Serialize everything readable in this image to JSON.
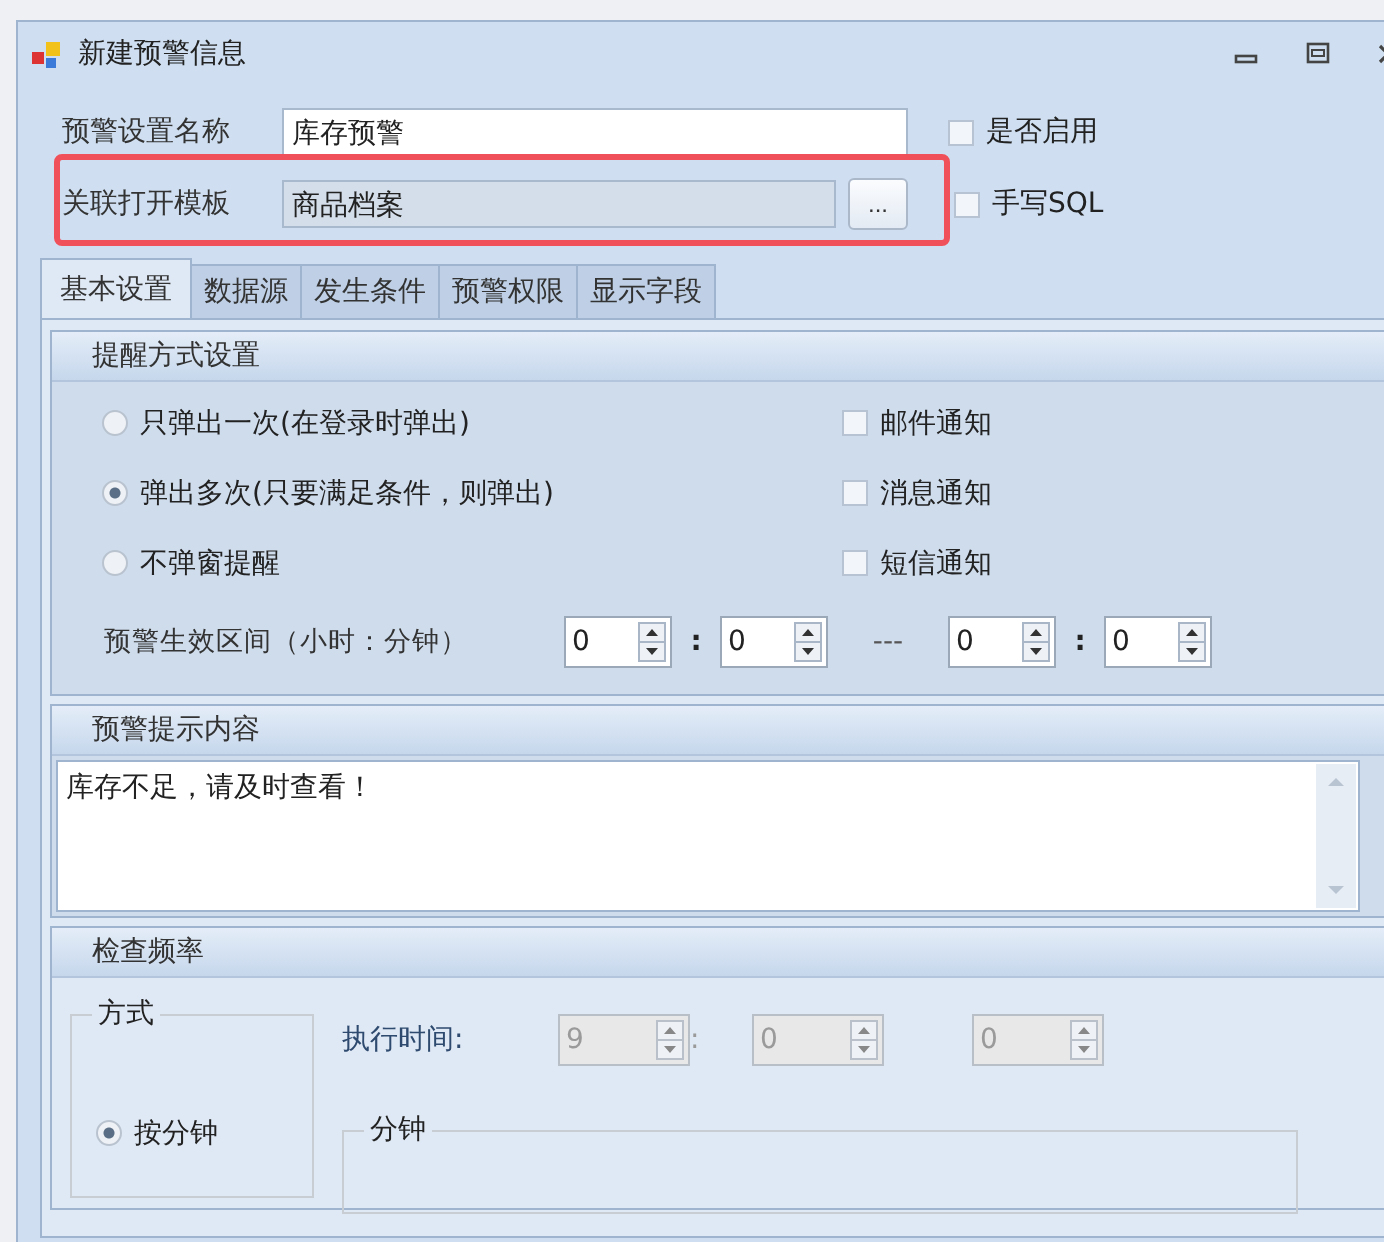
{
  "window": {
    "title": "新建预警信息"
  },
  "form": {
    "name_field": {
      "label": "预警设置名称",
      "value": "库存预警"
    },
    "enabled_checkbox": {
      "label": "是否启用",
      "checked": false
    },
    "template_field": {
      "label": "关联打开模板",
      "value": "商品档案",
      "disabled": true
    },
    "browse_button": {
      "label": "..."
    },
    "sql_checkbox": {
      "label": "手写SQL",
      "checked": false
    }
  },
  "tabs": [
    {
      "label": "基本设置",
      "selected": true
    },
    {
      "label": "数据源",
      "selected": false
    },
    {
      "label": "发生条件",
      "selected": false
    },
    {
      "label": "预警权限",
      "selected": false
    },
    {
      "label": "显示字段",
      "selected": false
    }
  ],
  "reminder_group": {
    "title": "提醒方式设置",
    "options": [
      {
        "label": "只弹出一次(在登录时弹出)",
        "selected": false
      },
      {
        "label": "弹出多次(只要满足条件，则弹出)",
        "selected": true
      },
      {
        "label": "不弹窗提醒",
        "selected": false
      }
    ],
    "notifications": [
      {
        "label": "邮件通知",
        "checked": false
      },
      {
        "label": "消息通知",
        "checked": false
      },
      {
        "label": "短信通知",
        "checked": false
      }
    ],
    "effective_range": {
      "label": "预警生效区间（小时：分钟）",
      "items": [
        {
          "kind": "spin",
          "value": "0",
          "disabled": false
        },
        {
          "kind": "sep",
          "text": ":"
        },
        {
          "kind": "spin",
          "value": "0",
          "disabled": false
        },
        {
          "kind": "sep",
          "text": "---"
        },
        {
          "kind": "spin",
          "value": "0",
          "disabled": false
        },
        {
          "kind": "sep",
          "text": ":"
        },
        {
          "kind": "spin",
          "value": "0",
          "disabled": false
        }
      ]
    }
  },
  "content_group": {
    "title": "预警提示内容",
    "text": "库存不足，请及时查看！"
  },
  "frequency_group": {
    "title": "检查频率",
    "mode_box": {
      "title": "方式",
      "options": [
        {
          "label": "按分钟",
          "selected": true
        }
      ]
    },
    "exec_time": {
      "label": "执行时间:",
      "items": [
        {
          "kind": "spin",
          "value": "9",
          "disabled": true
        },
        {
          "kind": "sep",
          "text": ":"
        },
        {
          "kind": "spin",
          "value": "0",
          "disabled": true
        },
        {
          "kind": "gap"
        },
        {
          "kind": "spin",
          "value": "0",
          "disabled": true
        }
      ]
    },
    "minute_box": {
      "title": "分钟"
    }
  }
}
